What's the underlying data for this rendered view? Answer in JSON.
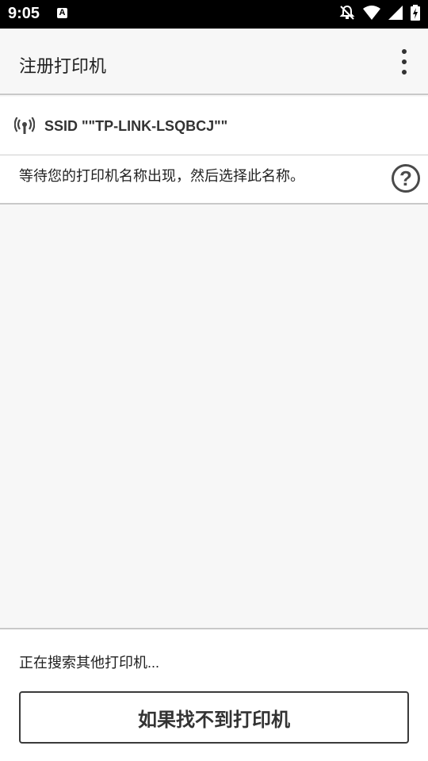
{
  "status_bar": {
    "time": "9:05",
    "a_glyph": "A",
    "icons": [
      "text-a-icon",
      "notifications-off-icon",
      "wifi-icon",
      "cell-signal-icon",
      "battery-charging-icon"
    ]
  },
  "app_bar": {
    "title": "注册打印机",
    "overflow_icon": "more-vert-icon"
  },
  "ssid": {
    "icon": "wireless-signal-icon",
    "label": "SSID \"\"TP-LINK-LSQBCJ\"\""
  },
  "instruction": {
    "text": "等待您的打印机名称出现，然后选择此名称。",
    "help_glyph": "?"
  },
  "bottom": {
    "searching_text": "正在搜索其他打印机...",
    "not_found_button": "如果找不到打印机"
  },
  "colors": {
    "background": "#f7f7f7",
    "status_bar": "#000000",
    "text": "#212121"
  }
}
